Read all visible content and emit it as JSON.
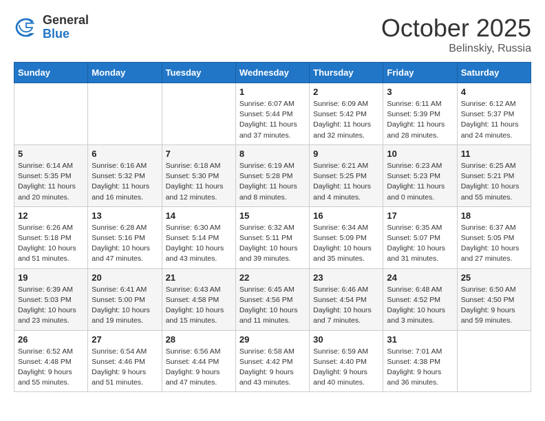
{
  "logo": {
    "general": "General",
    "blue": "Blue"
  },
  "title": "October 2025",
  "subtitle": "Belinskiy, Russia",
  "weekdays": [
    "Sunday",
    "Monday",
    "Tuesday",
    "Wednesday",
    "Thursday",
    "Friday",
    "Saturday"
  ],
  "weeks": [
    [
      {
        "day": "",
        "info": ""
      },
      {
        "day": "",
        "info": ""
      },
      {
        "day": "",
        "info": ""
      },
      {
        "day": "1",
        "info": "Sunrise: 6:07 AM\nSunset: 5:44 PM\nDaylight: 11 hours\nand 37 minutes."
      },
      {
        "day": "2",
        "info": "Sunrise: 6:09 AM\nSunset: 5:42 PM\nDaylight: 11 hours\nand 32 minutes."
      },
      {
        "day": "3",
        "info": "Sunrise: 6:11 AM\nSunset: 5:39 PM\nDaylight: 11 hours\nand 28 minutes."
      },
      {
        "day": "4",
        "info": "Sunrise: 6:12 AM\nSunset: 5:37 PM\nDaylight: 11 hours\nand 24 minutes."
      }
    ],
    [
      {
        "day": "5",
        "info": "Sunrise: 6:14 AM\nSunset: 5:35 PM\nDaylight: 11 hours\nand 20 minutes."
      },
      {
        "day": "6",
        "info": "Sunrise: 6:16 AM\nSunset: 5:32 PM\nDaylight: 11 hours\nand 16 minutes."
      },
      {
        "day": "7",
        "info": "Sunrise: 6:18 AM\nSunset: 5:30 PM\nDaylight: 11 hours\nand 12 minutes."
      },
      {
        "day": "8",
        "info": "Sunrise: 6:19 AM\nSunset: 5:28 PM\nDaylight: 11 hours\nand 8 minutes."
      },
      {
        "day": "9",
        "info": "Sunrise: 6:21 AM\nSunset: 5:25 PM\nDaylight: 11 hours\nand 4 minutes."
      },
      {
        "day": "10",
        "info": "Sunrise: 6:23 AM\nSunset: 5:23 PM\nDaylight: 11 hours\nand 0 minutes."
      },
      {
        "day": "11",
        "info": "Sunrise: 6:25 AM\nSunset: 5:21 PM\nDaylight: 10 hours\nand 55 minutes."
      }
    ],
    [
      {
        "day": "12",
        "info": "Sunrise: 6:26 AM\nSunset: 5:18 PM\nDaylight: 10 hours\nand 51 minutes."
      },
      {
        "day": "13",
        "info": "Sunrise: 6:28 AM\nSunset: 5:16 PM\nDaylight: 10 hours\nand 47 minutes."
      },
      {
        "day": "14",
        "info": "Sunrise: 6:30 AM\nSunset: 5:14 PM\nDaylight: 10 hours\nand 43 minutes."
      },
      {
        "day": "15",
        "info": "Sunrise: 6:32 AM\nSunset: 5:11 PM\nDaylight: 10 hours\nand 39 minutes."
      },
      {
        "day": "16",
        "info": "Sunrise: 6:34 AM\nSunset: 5:09 PM\nDaylight: 10 hours\nand 35 minutes."
      },
      {
        "day": "17",
        "info": "Sunrise: 6:35 AM\nSunset: 5:07 PM\nDaylight: 10 hours\nand 31 minutes."
      },
      {
        "day": "18",
        "info": "Sunrise: 6:37 AM\nSunset: 5:05 PM\nDaylight: 10 hours\nand 27 minutes."
      }
    ],
    [
      {
        "day": "19",
        "info": "Sunrise: 6:39 AM\nSunset: 5:03 PM\nDaylight: 10 hours\nand 23 minutes."
      },
      {
        "day": "20",
        "info": "Sunrise: 6:41 AM\nSunset: 5:00 PM\nDaylight: 10 hours\nand 19 minutes."
      },
      {
        "day": "21",
        "info": "Sunrise: 6:43 AM\nSunset: 4:58 PM\nDaylight: 10 hours\nand 15 minutes."
      },
      {
        "day": "22",
        "info": "Sunrise: 6:45 AM\nSunset: 4:56 PM\nDaylight: 10 hours\nand 11 minutes."
      },
      {
        "day": "23",
        "info": "Sunrise: 6:46 AM\nSunset: 4:54 PM\nDaylight: 10 hours\nand 7 minutes."
      },
      {
        "day": "24",
        "info": "Sunrise: 6:48 AM\nSunset: 4:52 PM\nDaylight: 10 hours\nand 3 minutes."
      },
      {
        "day": "25",
        "info": "Sunrise: 6:50 AM\nSunset: 4:50 PM\nDaylight: 9 hours\nand 59 minutes."
      }
    ],
    [
      {
        "day": "26",
        "info": "Sunrise: 6:52 AM\nSunset: 4:48 PM\nDaylight: 9 hours\nand 55 minutes."
      },
      {
        "day": "27",
        "info": "Sunrise: 6:54 AM\nSunset: 4:46 PM\nDaylight: 9 hours\nand 51 minutes."
      },
      {
        "day": "28",
        "info": "Sunrise: 6:56 AM\nSunset: 4:44 PM\nDaylight: 9 hours\nand 47 minutes."
      },
      {
        "day": "29",
        "info": "Sunrise: 6:58 AM\nSunset: 4:42 PM\nDaylight: 9 hours\nand 43 minutes."
      },
      {
        "day": "30",
        "info": "Sunrise: 6:59 AM\nSunset: 4:40 PM\nDaylight: 9 hours\nand 40 minutes."
      },
      {
        "day": "31",
        "info": "Sunrise: 7:01 AM\nSunset: 4:38 PM\nDaylight: 9 hours\nand 36 minutes."
      },
      {
        "day": "",
        "info": ""
      }
    ]
  ]
}
